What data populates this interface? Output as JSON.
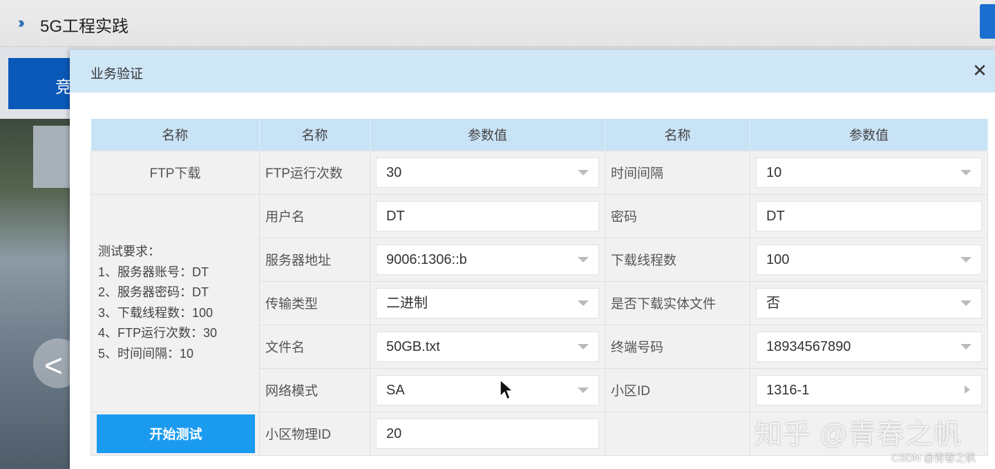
{
  "app": {
    "title": "5G工程实践",
    "nav_icon": "double-chevron-right-icon",
    "side_button_label": "竞"
  },
  "dialog": {
    "title": "业务验证",
    "close_icon": "close-icon",
    "headers": [
      "名称",
      "名称",
      "参数值",
      "名称",
      "参数值"
    ],
    "service_name": "FTP下载",
    "requirements_title": "测试要求：",
    "requirements": [
      "1、服务器账号：DT",
      "2、服务器密码：DT",
      "3、下载线程数：100",
      "4、FTP运行次数：30",
      "5、时间间隔：10"
    ],
    "start_button": "开始测试",
    "rows": [
      {
        "l_label": "FTP运行次数",
        "l_value": "30",
        "r_label": "时间间隔",
        "r_value": "10"
      },
      {
        "l_label": "用户名",
        "l_value": "DT",
        "r_label": "密码",
        "r_value": "DT"
      },
      {
        "l_label": "服务器地址",
        "l_value": "9006:1306::b",
        "r_label": "下载线程数",
        "r_value": "100"
      },
      {
        "l_label": "传输类型",
        "l_value": "二进制",
        "r_label": "是否下载实体文件",
        "r_value": "否"
      },
      {
        "l_label": "文件名",
        "l_value": "50GB.txt",
        "r_label": "终端号码",
        "r_value": "18934567890"
      },
      {
        "l_label": "网络模式",
        "l_value": "SA",
        "r_label": "小区ID",
        "r_value": "1316-1"
      },
      {
        "l_label": "小区物理ID",
        "l_value": "20"
      }
    ]
  },
  "watermark": "知乎 @青春之帆",
  "credit": "CSDN @青春之帆",
  "colors": {
    "header_bg": "#c9e3f6",
    "button": "#1b9bf0",
    "dialog_header": "#cfe6f7"
  }
}
